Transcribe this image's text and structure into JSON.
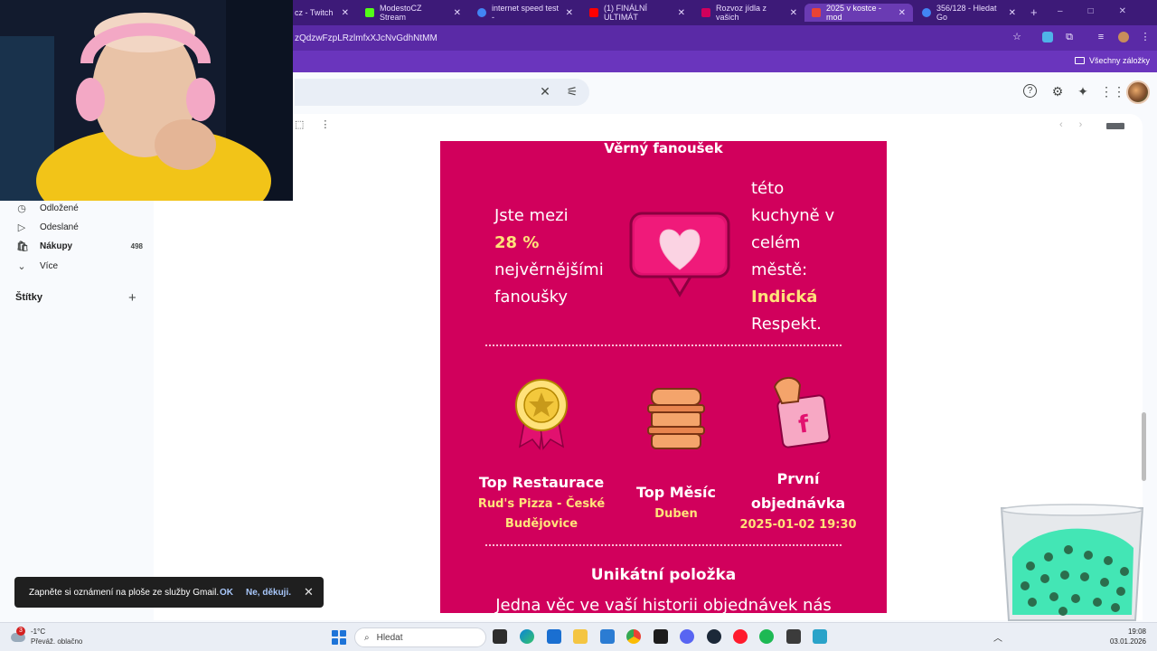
{
  "browser": {
    "tabs": [
      {
        "label": "cz - Twitch",
        "favicon_color": "#9146ff"
      },
      {
        "label": "ModestoCZ Stream",
        "favicon_color": "#53fc18"
      },
      {
        "label": "internet speed test -",
        "favicon_color": "#4285f4"
      },
      {
        "label": "(1) FINÁLNÍ ULTIMÁT",
        "favicon_color": "#ff0000"
      },
      {
        "label": "Rozvoz jídla z vašich",
        "favicon_color": "#d1005c"
      },
      {
        "label": "2025 v kostce - mod",
        "favicon_color": "#ea4335",
        "active": true
      },
      {
        "label": "356/128 - Hledat Go",
        "favicon_color": "#4285f4"
      }
    ],
    "url": "zQdzwFzpLRzlmfxXJcNvGdhNtMM",
    "bookmarks_all": "Všechny záložky"
  },
  "gmail": {
    "sidebar": {
      "items": [
        {
          "label": "Odložené",
          "icon": "clock-icon",
          "count": ""
        },
        {
          "label": "Odeslané",
          "icon": "send-icon",
          "count": ""
        },
        {
          "label": "Nákupy",
          "icon": "shopping-bag-icon",
          "count": "498",
          "bold": true
        },
        {
          "label": "Více",
          "icon": "chevron-down-icon",
          "count": ""
        }
      ],
      "labels_title": "Štítky"
    },
    "header_icons": [
      "help-icon",
      "settings-icon",
      "gemini-icon",
      "apps-icon",
      "avatar"
    ]
  },
  "email": {
    "heading": "Věrný fanoušek",
    "fan_left": {
      "line1": "Jste mezi",
      "highlight": "28 %",
      "line3": "nejvěrnějšími",
      "line4": "fanoušky"
    },
    "fan_right": {
      "line1": "této",
      "line2": "kuchyně v",
      "line3": "celém",
      "line4": "městě:",
      "highlight": "Indická",
      "line6": "Respekt."
    },
    "features": {
      "restaurant": {
        "title": "Top Restaurace",
        "value_line1": "Rud's Pizza - České",
        "value_line2": "Budějovice"
      },
      "month": {
        "title": "Top Měsíc",
        "value": "Duben"
      },
      "first_order": {
        "title_line1": "První",
        "title_line2": "objednávka",
        "value": "2025-01-02 19:30"
      }
    },
    "unique_title": "Unikátní položka",
    "unique_text": "Jedna věc ve vaší historii objednávek nás"
  },
  "notification": {
    "text": "Zapněte si oznámení na ploše ze služby Gmail.",
    "ok": "OK",
    "no": "Ne, děkuji."
  },
  "taskbar": {
    "weather_temp": "-1°C",
    "weather_desc": "Převáž. oblačno",
    "weather_badge": "3",
    "search_placeholder": "Hledat",
    "clock_time": "19:08",
    "clock_date": "03.01.2026"
  },
  "colors": {
    "card_bg": "#d1005c",
    "highlight": "#ffe27a",
    "tabbar": "#3d1a78",
    "toolbar": "#5a2aa6"
  }
}
